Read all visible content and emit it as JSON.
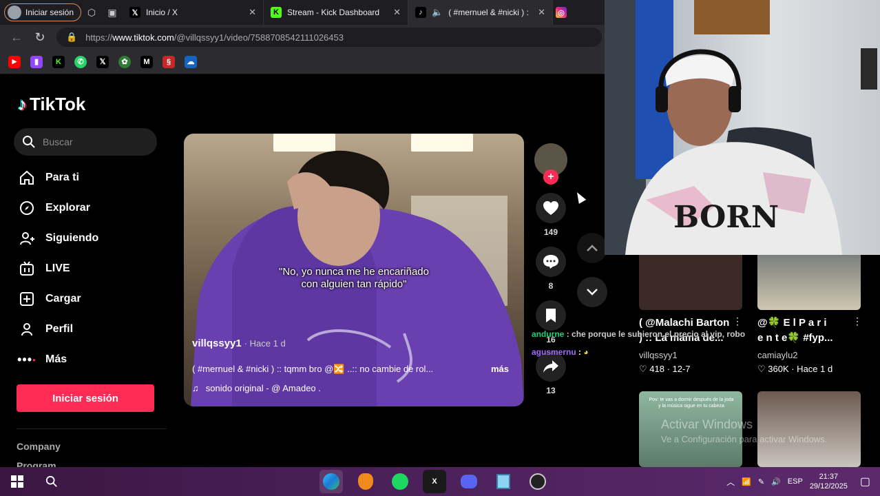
{
  "browser": {
    "profile_label": "Iniciar sesión",
    "tabs": [
      {
        "title": "Inicio / X",
        "favicon": "X"
      },
      {
        "title": "Stream - Kick Dashboard",
        "favicon": "K"
      },
      {
        "title": "( #mernuel & #nicki ) :",
        "favicon": "♪"
      }
    ],
    "url_prefix": "https://",
    "url_domain": "www.tiktok.com",
    "url_path": "/@villqssyy1/video/7588708542111026453"
  },
  "tiktok": {
    "logo_text": "TikTok",
    "search_placeholder": "Buscar",
    "nav": [
      {
        "label": "Para ti",
        "icon": "home-icon"
      },
      {
        "label": "Explorar",
        "icon": "compass-icon"
      },
      {
        "label": "Siguiendo",
        "icon": "following-icon"
      },
      {
        "label": "LIVE",
        "icon": "live-icon"
      },
      {
        "label": "Cargar",
        "icon": "upload-icon"
      },
      {
        "label": "Perfil",
        "icon": "profile-icon"
      },
      {
        "label": "Más",
        "icon": "more-icon"
      }
    ],
    "login_button": "Iniciar sesión",
    "footer_company": "Company",
    "footer_program": "Program"
  },
  "video": {
    "caption_line1": "\"No, yo nunca me he encariñado",
    "caption_line2": "con alguien tan rápido\"",
    "username": "villqssyy1",
    "time_ago": "· Hace 1 d",
    "description": "( #mernuel & #nicki ) :: tqmm bro @🔀 ..:: no cambie de rol...",
    "more_label": "más",
    "sound": "sonido original - @ Amadeo .",
    "likes": "149",
    "comments": "8",
    "saves": "16",
    "shares": "13"
  },
  "chat": [
    {
      "user": "andurne",
      "message": ": che porque le subieron el precio al vip, robo"
    },
    {
      "user": "agusmernu",
      "message": ":"
    }
  ],
  "related": [
    {
      "title_line1": "( @Malachi Barton",
      "title_line2": ") :: La mama de...",
      "author": "villqssyy1",
      "stats": "♡ 418 · 12-7"
    },
    {
      "title_line1": "@🍀 E l  P a r i",
      "title_line2": "e n t e🍀 #fyp...",
      "author": "camiaylu2",
      "stats": "♡ 360K · Hace 1 d"
    }
  ],
  "thumb_text": "Pov: te vas a dormir después de la joda y la música sigue en tu cabeza",
  "watermark": {
    "line1": "Activar Windows",
    "line2": "Ve a Configuración para activar Windows."
  },
  "taskbar": {
    "lang": "ESP",
    "time": "21:37",
    "date": "29/12/2025"
  }
}
